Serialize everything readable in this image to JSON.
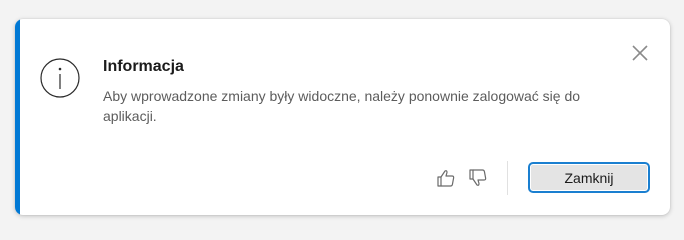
{
  "notification": {
    "title": "Informacja",
    "message": "Aby wprowadzone zmiany były widoczne, należy ponownie zalogować się do aplikacji.",
    "accent_color": "#0078d4",
    "icon": "info-icon",
    "close_icon": "close-icon",
    "feedback": {
      "positive_icon": "thumbs-up-icon",
      "negative_icon": "thumbs-down-icon"
    },
    "primary_button_label": "Zamknij"
  }
}
